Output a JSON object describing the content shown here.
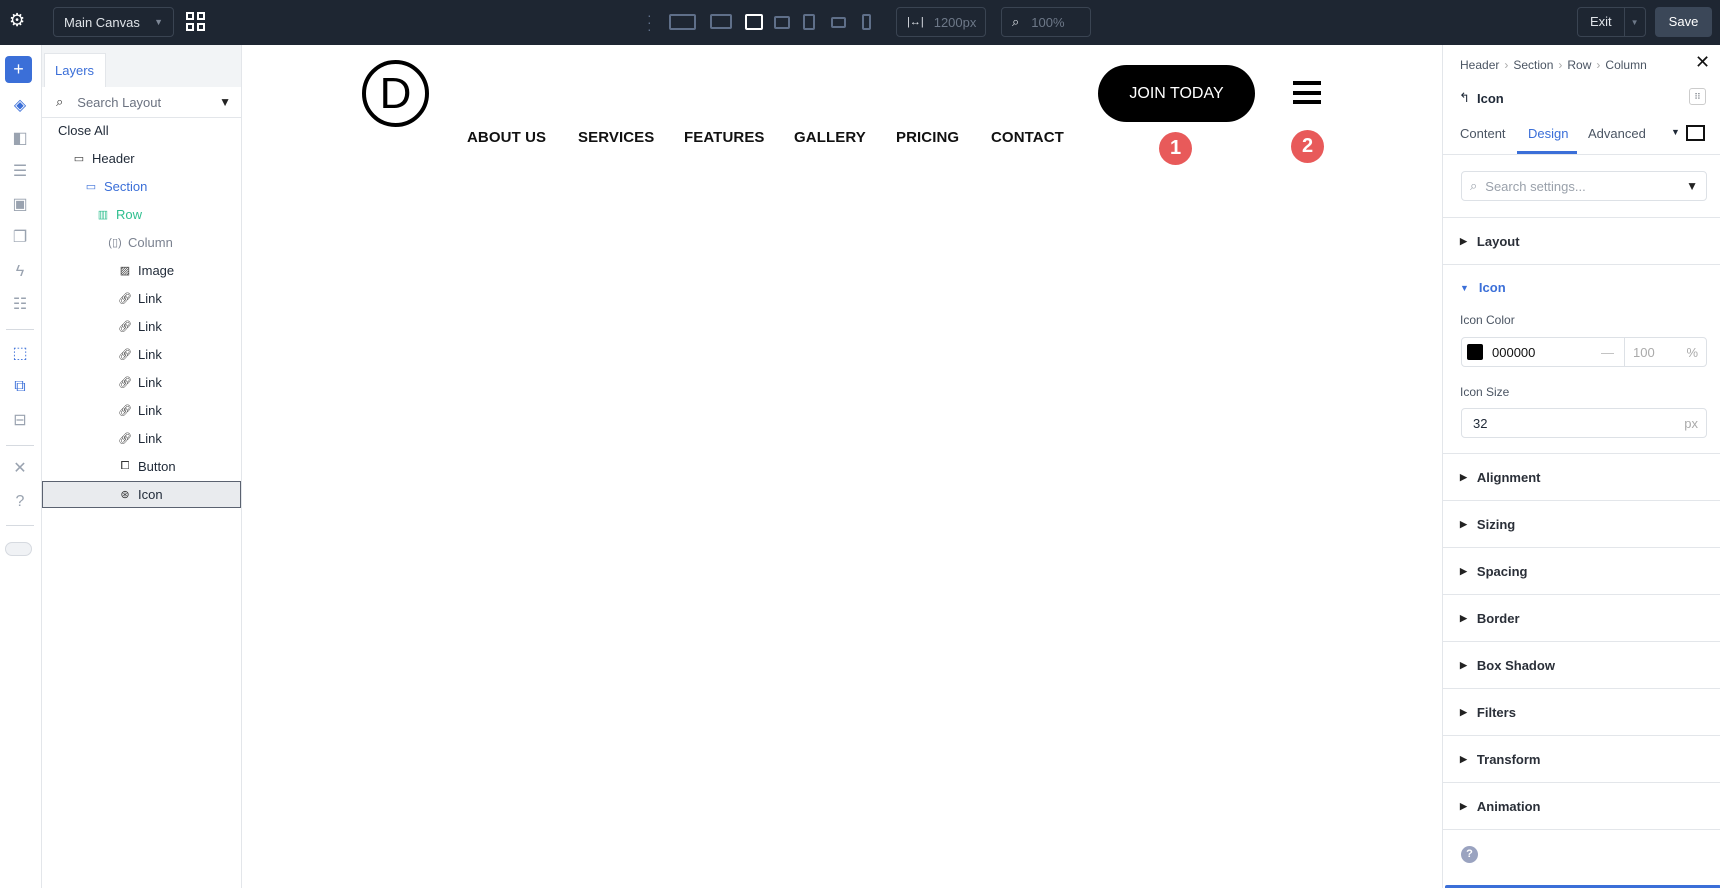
{
  "topbar": {
    "canvas_select": "Main Canvas",
    "width_value": "1200px",
    "zoom_value": "100%",
    "exit_label": "Exit",
    "save_label": "Save"
  },
  "layers": {
    "tab": "Layers",
    "search_placeholder": "Search Layout",
    "close_all": "Close All",
    "items": [
      {
        "label": "Header"
      },
      {
        "label": "Section"
      },
      {
        "label": "Row"
      },
      {
        "label": "Column"
      },
      {
        "label": "Image"
      },
      {
        "label": "Link"
      },
      {
        "label": "Link"
      },
      {
        "label": "Link"
      },
      {
        "label": "Link"
      },
      {
        "label": "Link"
      },
      {
        "label": "Link"
      },
      {
        "label": "Button"
      },
      {
        "label": "Icon"
      }
    ]
  },
  "canvas": {
    "logo_letter": "D",
    "nav": [
      "ABOUT US",
      "SERVICES",
      "FEATURES",
      "GALLERY",
      "PRICING",
      "CONTACT"
    ],
    "cta": "JOIN TODAY",
    "badges": [
      "1",
      "2"
    ]
  },
  "panel": {
    "breadcrumb": [
      "Header",
      "Section",
      "Row",
      "Column"
    ],
    "title": "Icon",
    "tabs": [
      "Content",
      "Design",
      "Advanced"
    ],
    "search_placeholder": "Search settings...",
    "sections": [
      "Layout",
      "Icon",
      "Alignment",
      "Sizing",
      "Spacing",
      "Border",
      "Box Shadow",
      "Filters",
      "Transform",
      "Animation"
    ],
    "icon_color_label": "Icon Color",
    "icon_color_value": "000000",
    "icon_color_swatch": "#000000",
    "opacity_value": "100",
    "opacity_unit": "%",
    "icon_size_label": "Icon Size",
    "icon_size_value": "32",
    "icon_size_unit": "px"
  },
  "colors": {
    "accent": "#3b6fd8",
    "topbar": "#1e2632",
    "badge": "#e85a5a"
  }
}
